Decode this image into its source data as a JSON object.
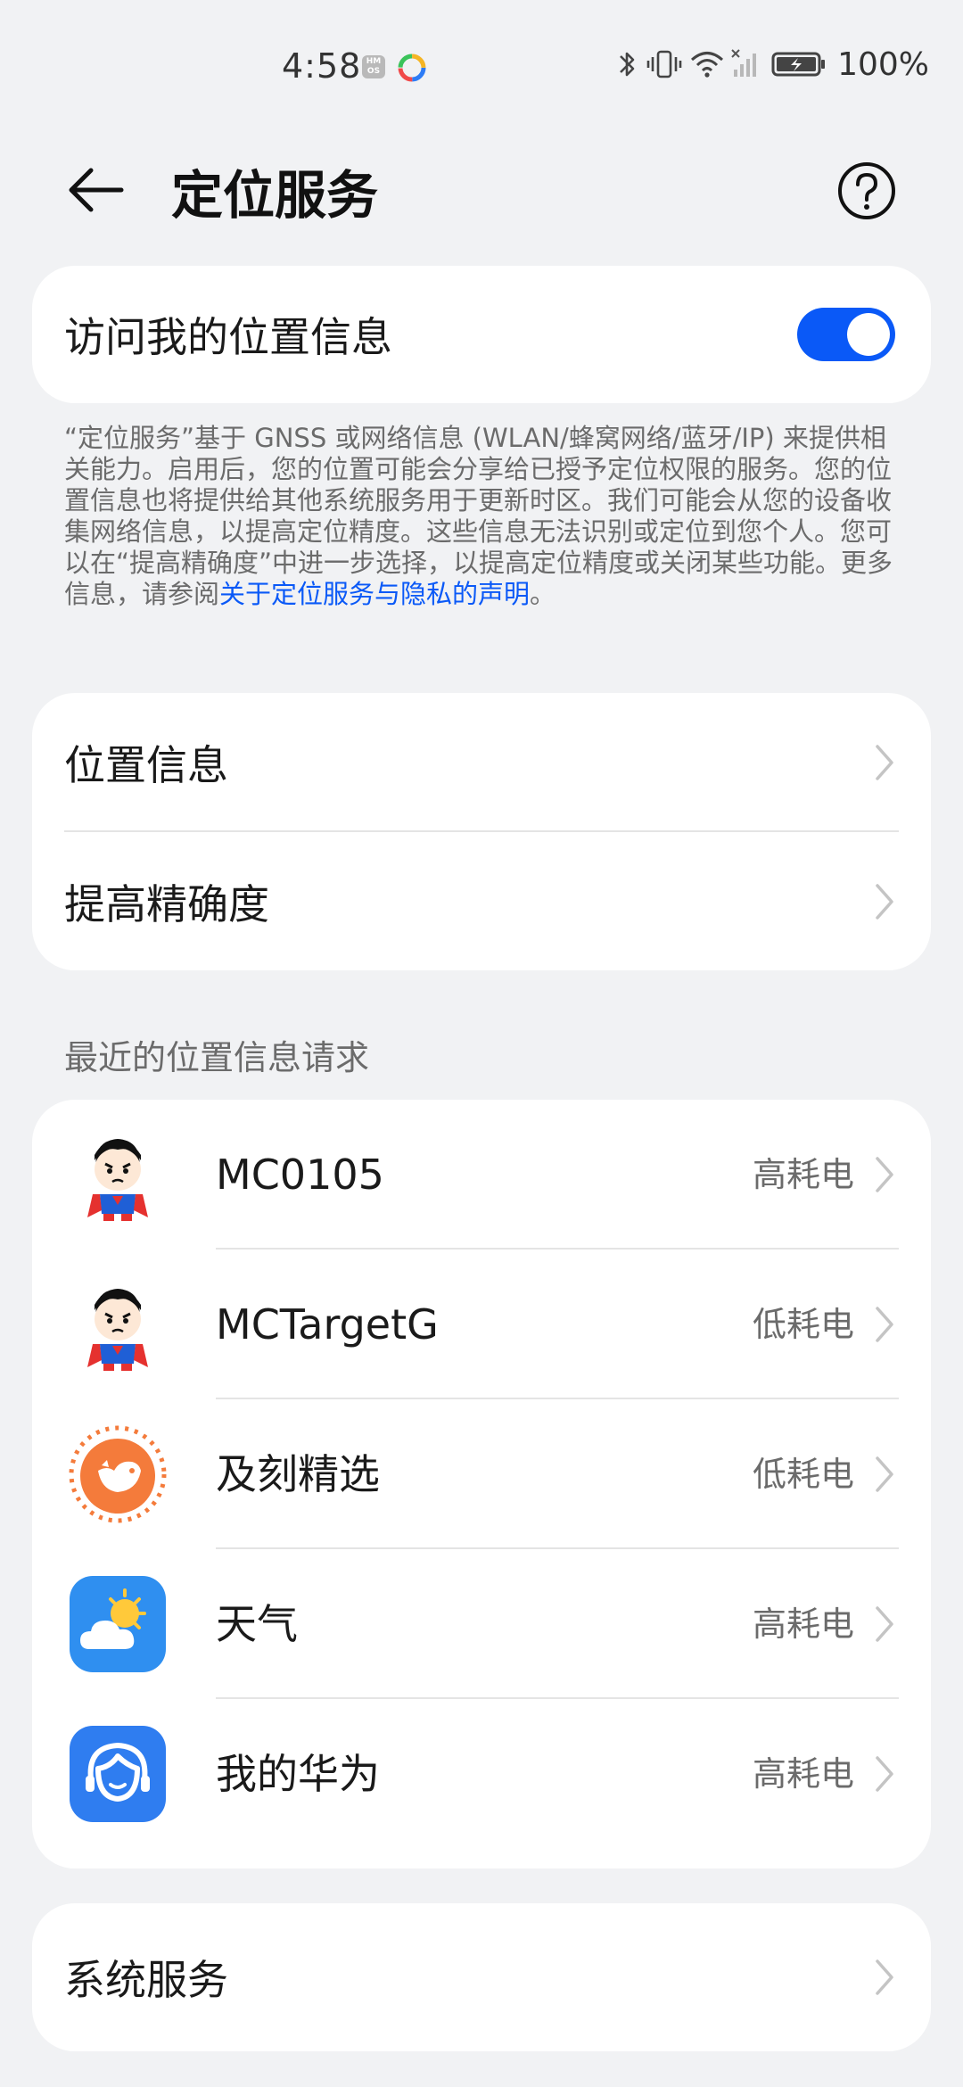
{
  "status_bar": {
    "time": "4:58",
    "hmos_badge": "HM OS",
    "battery": "100%"
  },
  "header": {
    "title": "定位服务",
    "back_icon": "arrow-left-icon",
    "help_icon": "question-circle-icon"
  },
  "location_access": {
    "label": "访问我的位置信息",
    "enabled": true
  },
  "description": {
    "text": "“定位服务”基于 GNSS 或网络信息 (WLAN/蜂窝网络/蓝牙/IP) 来提供相关能力。启用后，您的位置可能会分享给已授予定位权限的服务。您的位置信息也将提供给其他系统服务用于更新时区。我们可能会从您的设备收集网络信息，以提高定位精度。这些信息无法识别或定位到您个人。您可以在“提高精确度”中进一步选择，以提高定位精度或关闭某些功能。更多信息，请参阅",
    "link": "关于定位服务与隐私的声明",
    "suffix": "。"
  },
  "settings": [
    {
      "label": "位置信息"
    },
    {
      "label": "提高精确度"
    }
  ],
  "recent_requests": {
    "title": "最近的位置信息请求",
    "apps": [
      {
        "name": "MC0105",
        "power": "高耗电",
        "icon": "superhero-icon"
      },
      {
        "name": "MCTargetG",
        "power": "低耗电",
        "icon": "superhero-icon"
      },
      {
        "name": "及刻精选",
        "power": "低耗电",
        "icon": "bird-icon"
      },
      {
        "name": "天气",
        "power": "高耗电",
        "icon": "weather-icon"
      },
      {
        "name": "我的华为",
        "power": "高耗电",
        "icon": "my-huawei-icon"
      }
    ]
  },
  "system_services": {
    "label": "系统服务"
  },
  "colors": {
    "accent": "#0a59f7",
    "background": "#f1f2f4",
    "card": "#ffffff"
  }
}
